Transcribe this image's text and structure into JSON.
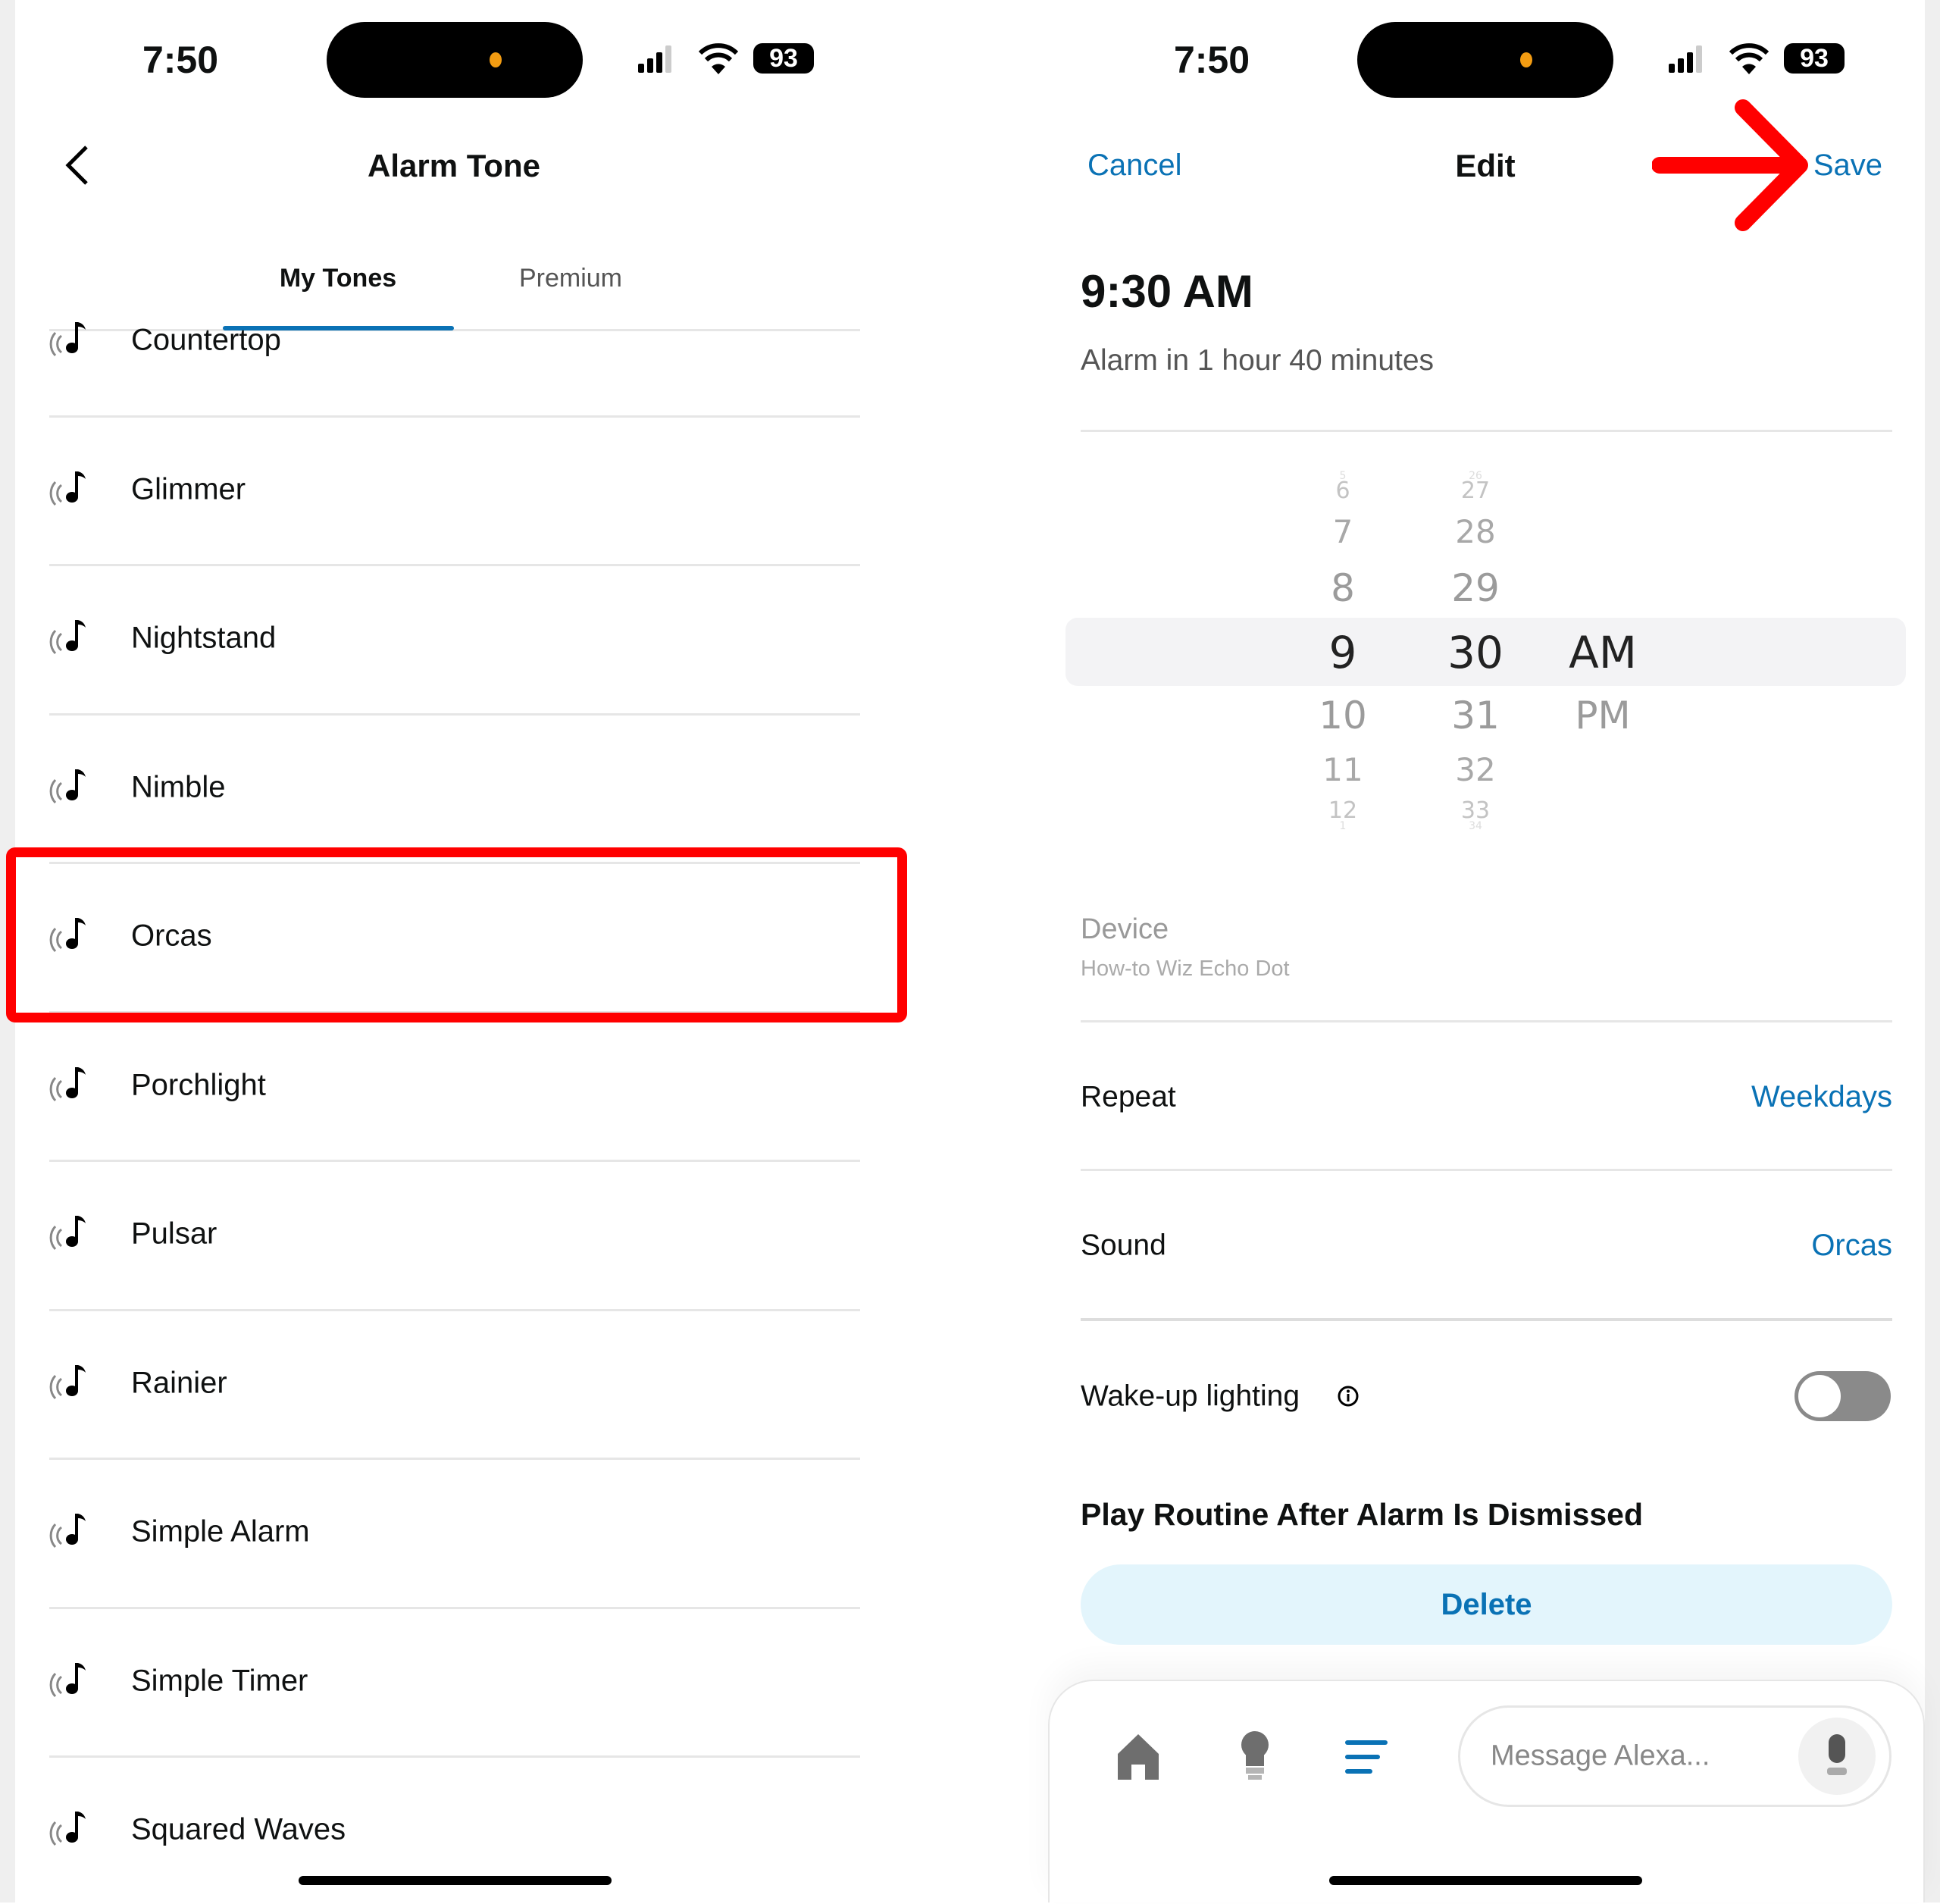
{
  "status_bar": {
    "time": "7:50",
    "battery": "93"
  },
  "left": {
    "title": "Alarm Tone",
    "tabs": [
      {
        "label": "My Tones",
        "active": true
      },
      {
        "label": "Premium",
        "active": false
      }
    ],
    "tones": [
      "Countertop",
      "Glimmer",
      "Nightstand",
      "Nimble",
      "Orcas",
      "Porchlight",
      "Pulsar",
      "Rainier",
      "Simple Alarm",
      "Simple Timer",
      "Squared Waves"
    ],
    "highlighted": "Orcas"
  },
  "right": {
    "cancel": "Cancel",
    "title": "Edit",
    "save": "Save",
    "alarm_time": "9:30 AM",
    "countdown": "Alarm in 1 hour 40 minutes",
    "picker": {
      "hours": [
        "5",
        "6",
        "7",
        "8",
        "9",
        "10",
        "11",
        "12",
        "1"
      ],
      "minutes": [
        "26",
        "27",
        "28",
        "29",
        "30",
        "31",
        "32",
        "33",
        "34"
      ],
      "periods": [
        "AM",
        "PM"
      ],
      "selected": {
        "hour": "9",
        "minute": "30",
        "period": "AM"
      }
    },
    "device_label": "Device",
    "device_value": "How-to Wiz Echo Dot",
    "repeat_label": "Repeat",
    "repeat_value": "Weekdays",
    "sound_label": "Sound",
    "sound_value": "Orcas",
    "wake_label": "Wake-up lighting",
    "wake_on": false,
    "routine_heading": "Play Routine After Alarm Is Dismissed",
    "delete": "Delete",
    "message_placeholder": "Message Alexa..."
  },
  "colors": {
    "accent": "#0a72b5",
    "annotation": "#ff0000",
    "delete_bg": "#e3f5fc"
  }
}
